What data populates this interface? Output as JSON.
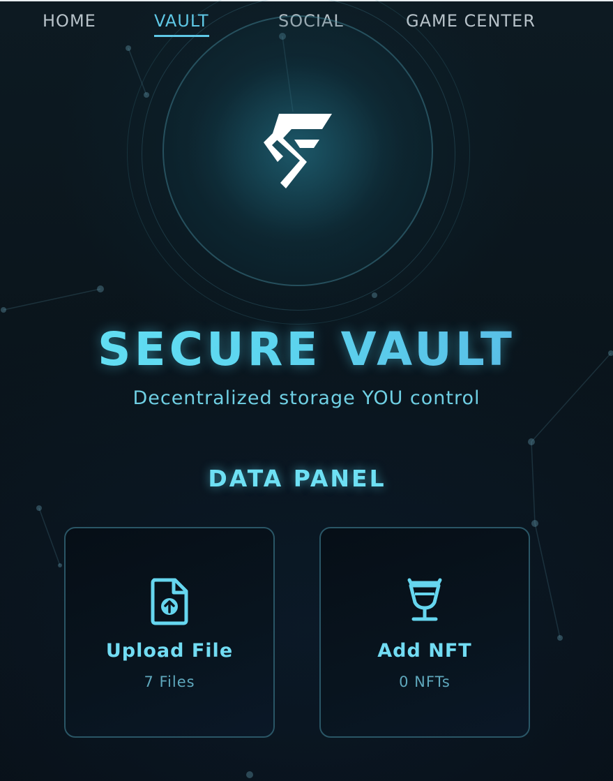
{
  "nav": {
    "items": [
      {
        "label": "HOME",
        "active": false
      },
      {
        "label": "VAULT",
        "active": true
      },
      {
        "label": "SOCIAL",
        "active": false
      },
      {
        "label": "GAME CENTER",
        "active": false
      }
    ]
  },
  "hero": {
    "logo_icon": "vault-logo-icon",
    "title": "SECURE VAULT",
    "subtitle": "Decentralized storage YOU control"
  },
  "data_panel": {
    "title": "DATA PANEL",
    "cards": [
      {
        "icon": "file-upload-icon",
        "label": "Upload File",
        "count": "7 Files"
      },
      {
        "icon": "nft-chalice-icon",
        "label": "Add NFT",
        "count": "0 NFTs"
      }
    ]
  },
  "colors": {
    "accent": "#5fc8e6",
    "title_glow": "#6ae6f6",
    "card_border": "#2a5666",
    "background": "#0a1219"
  }
}
